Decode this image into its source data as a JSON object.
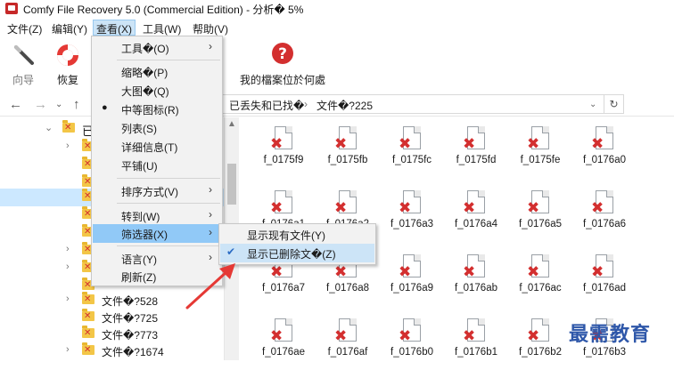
{
  "window": {
    "title": "Comfy File Recovery 5.0 (Commercial Edition) - 分析� 5%"
  },
  "menubar": [
    {
      "label": "文件(Z)"
    },
    {
      "label": "编辑(Y)"
    },
    {
      "label": "查看(X)"
    },
    {
      "label": "工具(W)"
    },
    {
      "label": "帮助(V)"
    }
  ],
  "toolbar": {
    "back_label": "向导",
    "restore_label": "恢复",
    "where_label": "我的檔案位於何處"
  },
  "address": {
    "crumbs": [
      "已丢失和已找�",
      "文件�?225"
    ]
  },
  "tree": {
    "top_label": "已",
    "items": [
      "文件�?528",
      "文件�?725",
      "文件�?773",
      "文件�?1674"
    ]
  },
  "view_menu": {
    "items": [
      "工具�(O)",
      "缩略�(P)",
      "大图�(Q)",
      "中等图标(R)",
      "列表(S)",
      "详细信息(T)",
      "平铺(U)",
      "排序方式(V)",
      "转到(W)",
      "筛选器(X)",
      "语言(Y)",
      "刷新(Z)"
    ]
  },
  "filter_submenu": {
    "items": [
      "显示现有文件(Y)",
      "显示已删除文�(Z)"
    ]
  },
  "files": [
    [
      "f_0175f9",
      "f_0175fb",
      "f_0175fc",
      "f_0175fd",
      "f_0175fe",
      "f_0176a0"
    ],
    [
      "f_0176a1",
      "f_0176a2",
      "f_0176a3",
      "f_0176a4",
      "f_0176a5",
      "f_0176a6"
    ],
    [
      "f_0176a7",
      "f_0176a8",
      "f_0176a9",
      "f_0176ab",
      "f_0176ac",
      "f_0176ad"
    ],
    [
      "f_0176ae",
      "f_0176af",
      "f_0176b0",
      "f_0176b1",
      "f_0176b2",
      "f_0176b3"
    ]
  ],
  "watermark": "最需教育",
  "colors": {
    "accent_red": "#d32f2f",
    "menu_highlight": "#91c9f7",
    "watermark_blue": "#2e57a9"
  }
}
